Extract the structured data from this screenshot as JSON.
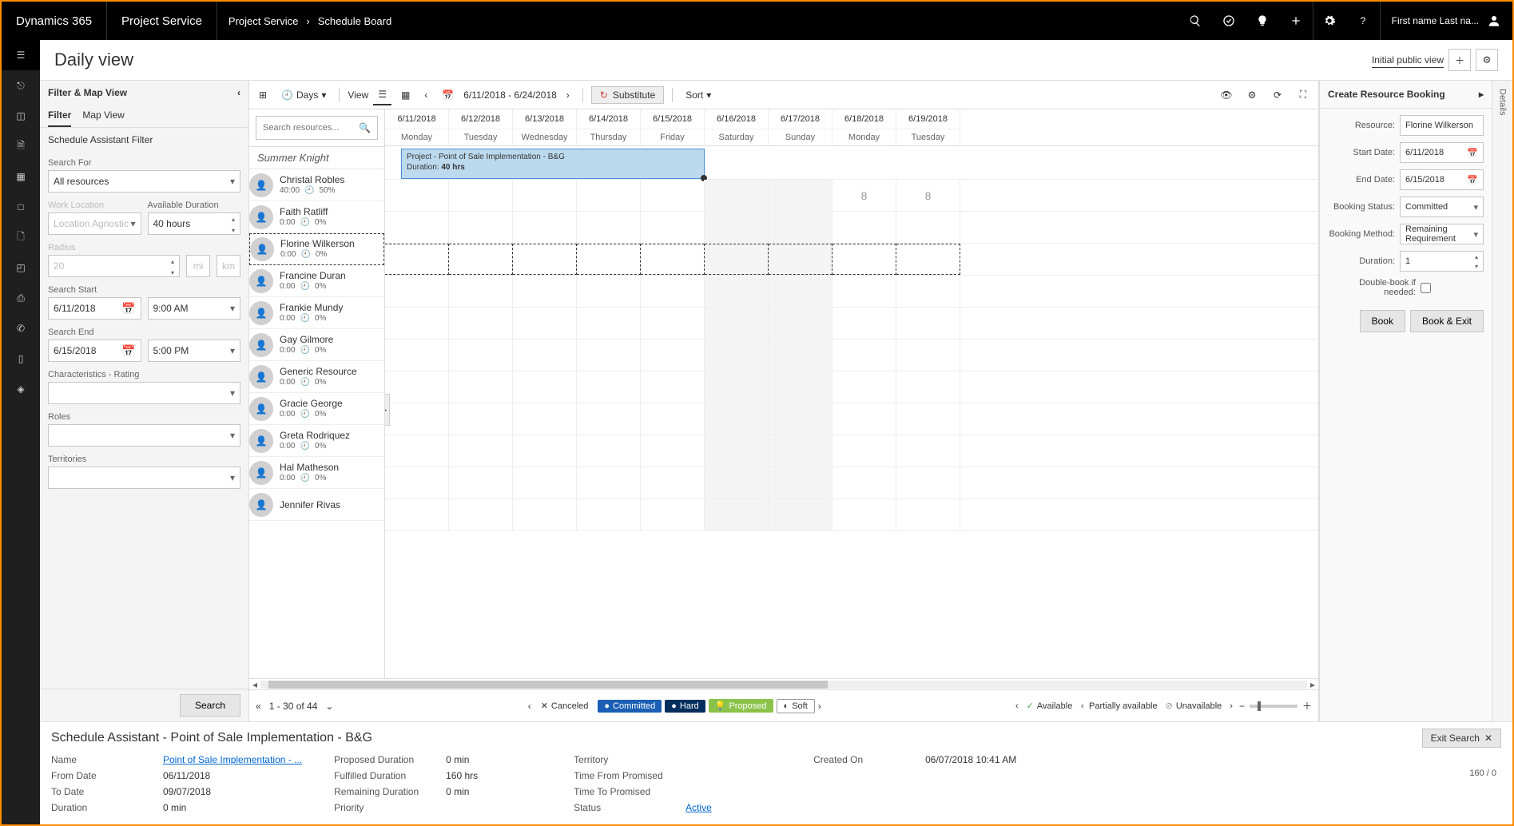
{
  "topbar": {
    "brand": "Dynamics 365",
    "app": "Project Service",
    "crumb1": "Project Service",
    "crumb2": "Schedule Board",
    "user": "First name Last na..."
  },
  "page": {
    "title": "Daily view",
    "view_name": "Initial public view"
  },
  "filter": {
    "panel_title": "Filter & Map View",
    "tab_filter": "Filter",
    "tab_map": "Map View",
    "section": "Schedule Assistant Filter",
    "search_for_label": "Search For",
    "search_for_value": "All resources",
    "work_location_label": "Work Location",
    "work_location_value": "Location Agnostic",
    "avail_dur_label": "Available Duration",
    "avail_dur_value": "40 hours",
    "radius_label": "Radius",
    "radius_value": "20",
    "unit_mi": "mi",
    "unit_km": "km",
    "search_start_label": "Search Start",
    "search_start_date": "6/11/2018",
    "search_start_time": "9:00 AM",
    "search_end_label": "Search End",
    "search_end_date": "6/15/2018",
    "search_end_time": "5:00 PM",
    "characteristics_label": "Characteristics - Rating",
    "roles_label": "Roles",
    "territories_label": "Territories",
    "search_btn": "Search"
  },
  "toolbar": {
    "days_label": "Days",
    "view_label": "View",
    "date_range": "6/11/2018 - 6/24/2018",
    "substitute": "Substitute",
    "sort": "Sort"
  },
  "board": {
    "search_placeholder": "Search resources...",
    "caption": "Summer Knight",
    "columns": [
      {
        "date": "6/11/2018",
        "day": "Monday",
        "wk": false
      },
      {
        "date": "6/12/2018",
        "day": "Tuesday",
        "wk": false
      },
      {
        "date": "6/13/2018",
        "day": "Wednesday",
        "wk": false
      },
      {
        "date": "6/14/2018",
        "day": "Thursday",
        "wk": false
      },
      {
        "date": "6/15/2018",
        "day": "Friday",
        "wk": false
      },
      {
        "date": "6/16/2018",
        "day": "Saturday",
        "wk": true
      },
      {
        "date": "6/17/2018",
        "day": "Sunday",
        "wk": true
      },
      {
        "date": "6/18/2018",
        "day": "Monday",
        "wk": false
      },
      {
        "date": "6/19/2018",
        "day": "Tuesday",
        "wk": false
      }
    ],
    "resources": [
      {
        "name": "Christal Robles",
        "hours": "40:00",
        "pct": "50%",
        "selected": false,
        "badges": {
          "7": "8",
          "8": "8"
        }
      },
      {
        "name": "Faith Ratliff",
        "hours": "0:00",
        "pct": "0%",
        "selected": false
      },
      {
        "name": "Florine Wilkerson",
        "hours": "0:00",
        "pct": "0%",
        "selected": true
      },
      {
        "name": "Francine Duran",
        "hours": "0:00",
        "pct": "0%",
        "selected": false
      },
      {
        "name": "Frankie Mundy",
        "hours": "0:00",
        "pct": "0%",
        "selected": false
      },
      {
        "name": "Gay Gilmore",
        "hours": "0:00",
        "pct": "0%",
        "selected": false
      },
      {
        "name": "Generic Resource",
        "hours": "0:00",
        "pct": "0%",
        "selected": false
      },
      {
        "name": "Gracie George",
        "hours": "0:00",
        "pct": "0%",
        "selected": false
      },
      {
        "name": "Greta Rodriquez",
        "hours": "0:00",
        "pct": "0%",
        "selected": false
      },
      {
        "name": "Hal Matheson",
        "hours": "0:00",
        "pct": "0%",
        "selected": false
      },
      {
        "name": "Jennifer Rivas",
        "hours": "",
        "pct": "",
        "selected": false
      }
    ],
    "booking_card": {
      "title": "Project - Point of Sale Implementation - B&G",
      "duration_label": "Duration:",
      "duration_value": "40 hrs"
    },
    "pager": "1 - 30 of 44",
    "legend": {
      "canceled": "Canceled",
      "committed": "Committed",
      "hard": "Hard",
      "proposed": "Proposed",
      "soft": "Soft"
    },
    "availability": {
      "available": "Available",
      "partially": "Partially available",
      "unavailable": "Unavailable"
    }
  },
  "booking_panel": {
    "title": "Create Resource Booking",
    "resource_label": "Resource:",
    "resource_value": "Florine Wilkerson",
    "start_label": "Start Date:",
    "start_value": "6/11/2018",
    "end_label": "End Date:",
    "end_value": "6/15/2018",
    "status_label": "Booking Status:",
    "status_value": "Committed",
    "method_label": "Booking Method:",
    "method_value": "Remaining Requirement",
    "duration_label": "Duration:",
    "duration_value": "1",
    "double_label": "Double-book if needed:",
    "book_btn": "Book",
    "book_exit_btn": "Book & Exit"
  },
  "details_label": "Details",
  "assist": {
    "title": "Schedule Assistant - Point of Sale Implementation - B&G",
    "exit_label": "Exit Search",
    "name_k": "Name",
    "name_v": "Point of Sale Implementation - ...",
    "from_k": "From Date",
    "from_v": "06/11/2018",
    "to_k": "To Date",
    "to_v": "09/07/2018",
    "dur_k": "Duration",
    "dur_v": "0 min",
    "propd_k": "Proposed Duration",
    "propd_v": "0 min",
    "fulfd_k": "Fulfilled Duration",
    "fulfd_v": "160 hrs",
    "remd_k": "Remaining Duration",
    "remd_v": "0 min",
    "prio_k": "Priority",
    "prio_v": "",
    "terr_k": "Territory",
    "terr_v": "",
    "tfp_k": "Time From Promised",
    "tfp_v": "",
    "ttp_k": "Time To Promised",
    "ttp_v": "",
    "stat_k": "Status",
    "stat_v": "Active",
    "created_k": "Created On",
    "created_v": "06/07/2018 10:41 AM",
    "counter": "160 / 0"
  }
}
